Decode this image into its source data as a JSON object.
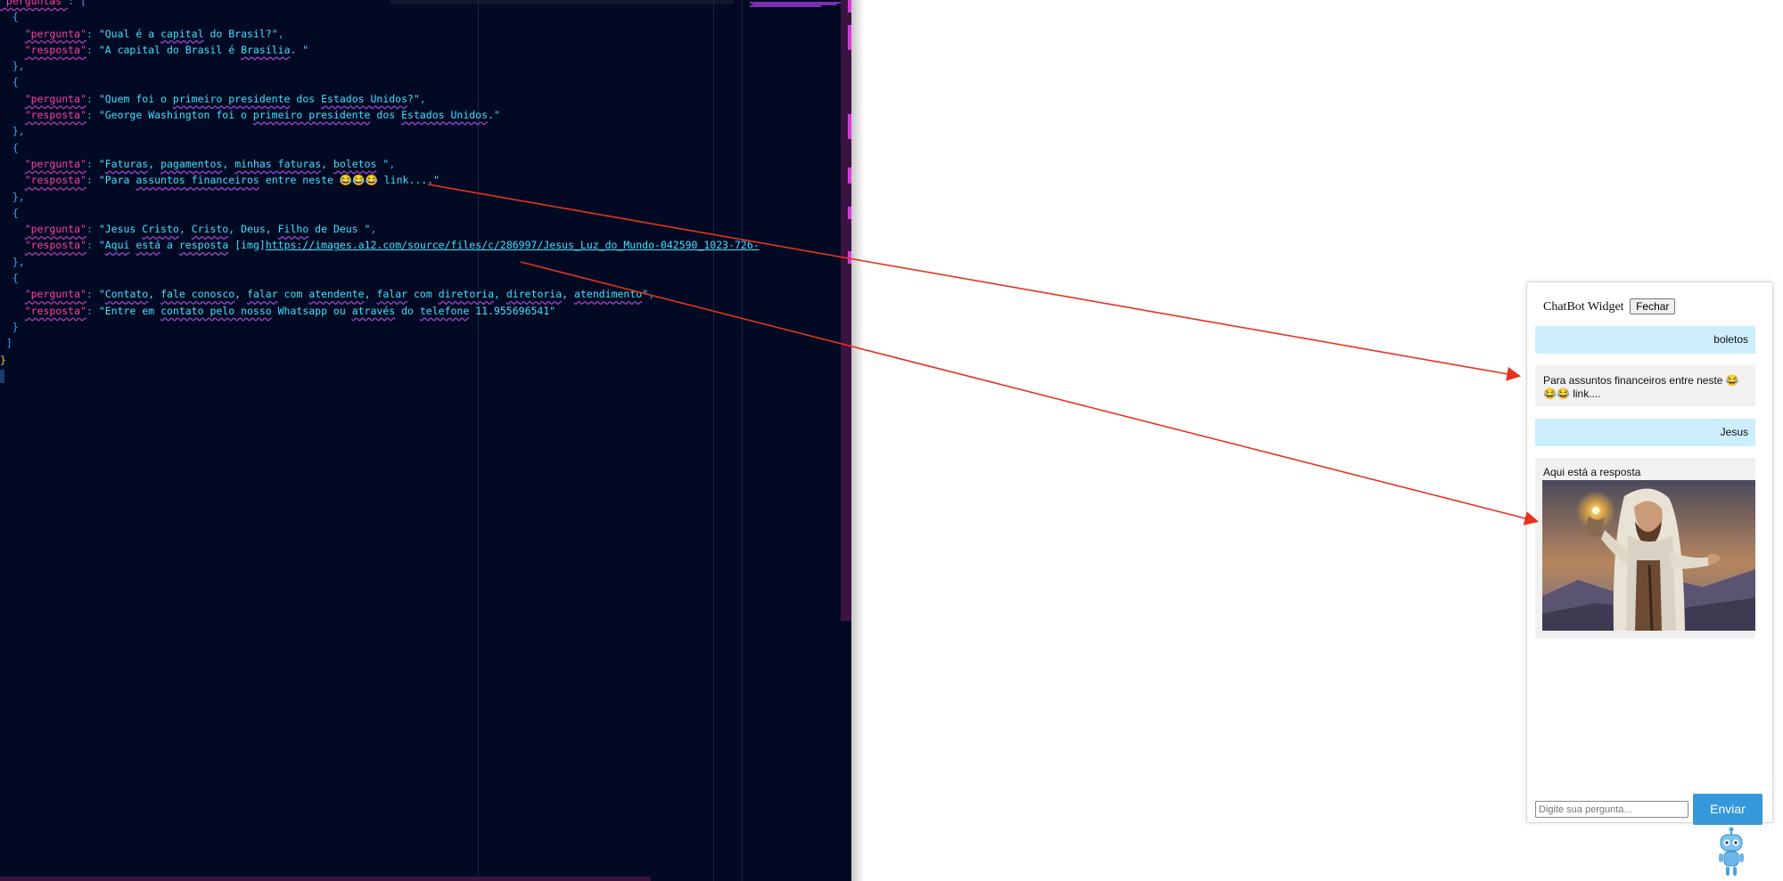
{
  "editor": {
    "lines": [
      [
        [
          "k",
          "\"perguntas\""
        ],
        [
          "p",
          ": ["
        ]
      ],
      [
        [
          "p",
          "  {"
        ]
      ],
      [
        [
          "p",
          "    "
        ],
        [
          "k",
          "\"pergunta\""
        ],
        [
          "p",
          ": "
        ],
        [
          "s",
          "\"Qual é a "
        ],
        [
          "su",
          "capital"
        ],
        [
          "s",
          " do Brasil?\""
        ],
        [
          "p",
          ","
        ]
      ],
      [
        [
          "p",
          "    "
        ],
        [
          "k",
          "\"resposta\""
        ],
        [
          "p",
          ": "
        ],
        [
          "s",
          "\"A capital do Brasil é "
        ],
        [
          "su",
          "Brasília"
        ],
        [
          "s",
          ". \""
        ]
      ],
      [
        [
          "p",
          "  },"
        ]
      ],
      [
        [
          "p",
          "  {"
        ]
      ],
      [
        [
          "p",
          "    "
        ],
        [
          "k",
          "\"pergunta\""
        ],
        [
          "p",
          ": "
        ],
        [
          "s",
          "\"Quem foi o "
        ],
        [
          "su",
          "primeiro presidente"
        ],
        [
          "s",
          " dos "
        ],
        [
          "su",
          "Estados Unidos"
        ],
        [
          "s",
          "?\""
        ],
        [
          "p",
          ","
        ]
      ],
      [
        [
          "p",
          "    "
        ],
        [
          "k",
          "\"resposta\""
        ],
        [
          "p",
          ": "
        ],
        [
          "s",
          "\"George Washington foi o "
        ],
        [
          "su",
          "primeiro presidente"
        ],
        [
          "s",
          " dos "
        ],
        [
          "su",
          "Estados Unidos"
        ],
        [
          "s",
          ".\""
        ]
      ],
      [
        [
          "p",
          "  },"
        ]
      ],
      [
        [
          "p",
          "  {"
        ]
      ],
      [
        [
          "p",
          "    "
        ],
        [
          "k",
          "\"pergunta\""
        ],
        [
          "p",
          ": "
        ],
        [
          "s",
          "\""
        ],
        [
          "su",
          "Faturas"
        ],
        [
          "s",
          ", "
        ],
        [
          "su",
          "pagamentos"
        ],
        [
          "s",
          ", "
        ],
        [
          "su",
          "minhas faturas"
        ],
        [
          "s",
          ", "
        ],
        [
          "su",
          "boletos"
        ],
        [
          "s",
          " \""
        ],
        [
          "p",
          ","
        ]
      ],
      [
        [
          "p",
          "    "
        ],
        [
          "k",
          "\"resposta\""
        ],
        [
          "p",
          ": "
        ],
        [
          "s",
          "\"Para "
        ],
        [
          "su",
          "assuntos financeiros"
        ],
        [
          "s",
          " entre neste 😂😂😂 link....\""
        ]
      ],
      [
        [
          "p",
          "  },"
        ]
      ],
      [
        [
          "p",
          "  {"
        ]
      ],
      [
        [
          "p",
          "    "
        ],
        [
          "k",
          "\"pergunta\""
        ],
        [
          "p",
          ": "
        ],
        [
          "s",
          "\"Jesus "
        ],
        [
          "su",
          "Cristo"
        ],
        [
          "s",
          ", "
        ],
        [
          "su",
          "Cristo"
        ],
        [
          "s",
          ", Deus, "
        ],
        [
          "su",
          "Filho"
        ],
        [
          "s",
          " de Deus \""
        ],
        [
          "p",
          ","
        ]
      ],
      [
        [
          "p",
          "    "
        ],
        [
          "k",
          "\"resposta\""
        ],
        [
          "p",
          ": "
        ],
        [
          "s",
          "\""
        ],
        [
          "su",
          "Aqui"
        ],
        [
          "s",
          " "
        ],
        [
          "su",
          "está"
        ],
        [
          "s",
          " a "
        ],
        [
          "su",
          "resposta"
        ],
        [
          "s",
          " [img]"
        ],
        [
          "sl",
          "https://images.a12.com/source/files/c/286997/Jesus_Luz_do_Mundo-042590_1023-726-"
        ]
      ],
      [
        [
          "p",
          "  },"
        ]
      ],
      [
        [
          "p",
          "  {"
        ]
      ],
      [
        [
          "p",
          "    "
        ],
        [
          "k",
          "\"pergunta\""
        ],
        [
          "p",
          ": "
        ],
        [
          "s",
          "\""
        ],
        [
          "su",
          "Contato"
        ],
        [
          "s",
          ", "
        ],
        [
          "su",
          "fale conosco"
        ],
        [
          "s",
          ", "
        ],
        [
          "su",
          "falar"
        ],
        [
          "s",
          " com "
        ],
        [
          "su",
          "atendente"
        ],
        [
          "s",
          ", "
        ],
        [
          "su",
          "falar"
        ],
        [
          "s",
          " com "
        ],
        [
          "su",
          "diretoria"
        ],
        [
          "s",
          ", "
        ],
        [
          "su",
          "diretoria"
        ],
        [
          "s",
          ", "
        ],
        [
          "su",
          "atendimento"
        ],
        [
          "s",
          "\""
        ],
        [
          "p",
          ","
        ]
      ],
      [
        [
          "p",
          "    "
        ],
        [
          "k",
          "\"resposta\""
        ],
        [
          "p",
          ": "
        ],
        [
          "s",
          "\"Entre em "
        ],
        [
          "su",
          "contato pelo nosso"
        ],
        [
          "s",
          " Whatsapp ou "
        ],
        [
          "su",
          "através"
        ],
        [
          "s",
          " do "
        ],
        [
          "su",
          "telefone"
        ],
        [
          "s",
          " 11.955696541\""
        ]
      ],
      [
        [
          "p",
          "  }"
        ]
      ],
      [
        [
          "p",
          " ]"
        ]
      ],
      [
        [
          "b",
          "}"
        ]
      ]
    ]
  },
  "widget": {
    "title": "ChatBot Widget",
    "close_label": "Fechar",
    "messages": [
      {
        "role": "user",
        "text": "boletos"
      },
      {
        "role": "bot",
        "text": "Para assuntos financeiros entre neste 😂😂😂 link...."
      },
      {
        "role": "user",
        "text": "Jesus"
      },
      {
        "role": "bot",
        "text": "Aqui está a resposta"
      }
    ],
    "input_placeholder": "Digite sua pergunta...",
    "send_label": "Enviar"
  },
  "colors": {
    "editor_bg": "#020a23",
    "key": "#ff3fa4",
    "string": "#3fe0ff",
    "user_bubble": "#cdeefd",
    "bot_bubble": "#f1f1f1",
    "send_button": "#3498db",
    "arrow": "#e8321e"
  }
}
